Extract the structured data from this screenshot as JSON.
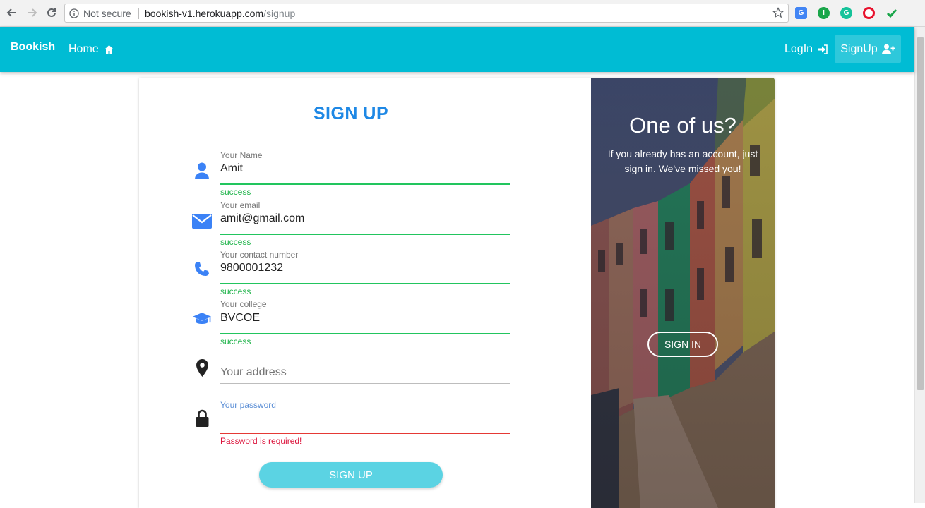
{
  "browser": {
    "security_label": "Not secure",
    "url_host": "bookish-v1.herokuapp.com",
    "url_path": "/signup"
  },
  "navbar": {
    "brand": "Bookish",
    "home": "Home",
    "login": "LogIn",
    "signup": "SignUp",
    "color": "#00bcd4"
  },
  "form": {
    "heading": "SIGN UP",
    "fields": [
      {
        "label": "Your Name",
        "value": "Amit",
        "helper": "success",
        "icon": "user-icon"
      },
      {
        "label": "Your email",
        "value": "amit@gmail.com",
        "helper": "success",
        "icon": "envelope-icon"
      },
      {
        "label": "Your contact number",
        "value": "9800001232",
        "helper": "success",
        "icon": "phone-icon"
      },
      {
        "label": "Your college",
        "value": "BVCOE",
        "helper": "success",
        "icon": "graduation-cap-icon"
      },
      {
        "placeholder": "Your address",
        "icon": "map-marker-icon"
      },
      {
        "label": "Your password",
        "value": "",
        "helper": "Password is required!",
        "icon": "lock-icon"
      }
    ],
    "submit": "SIGN UP"
  },
  "side_panel": {
    "title": "One of us?",
    "text": "If you already has an account, just sign in. We've missed you!",
    "button": "SIGN IN"
  },
  "colors": {
    "accent": "#1e88e5",
    "success": "#22c55e",
    "error": "#e53935",
    "icon": "#3b82f6"
  }
}
